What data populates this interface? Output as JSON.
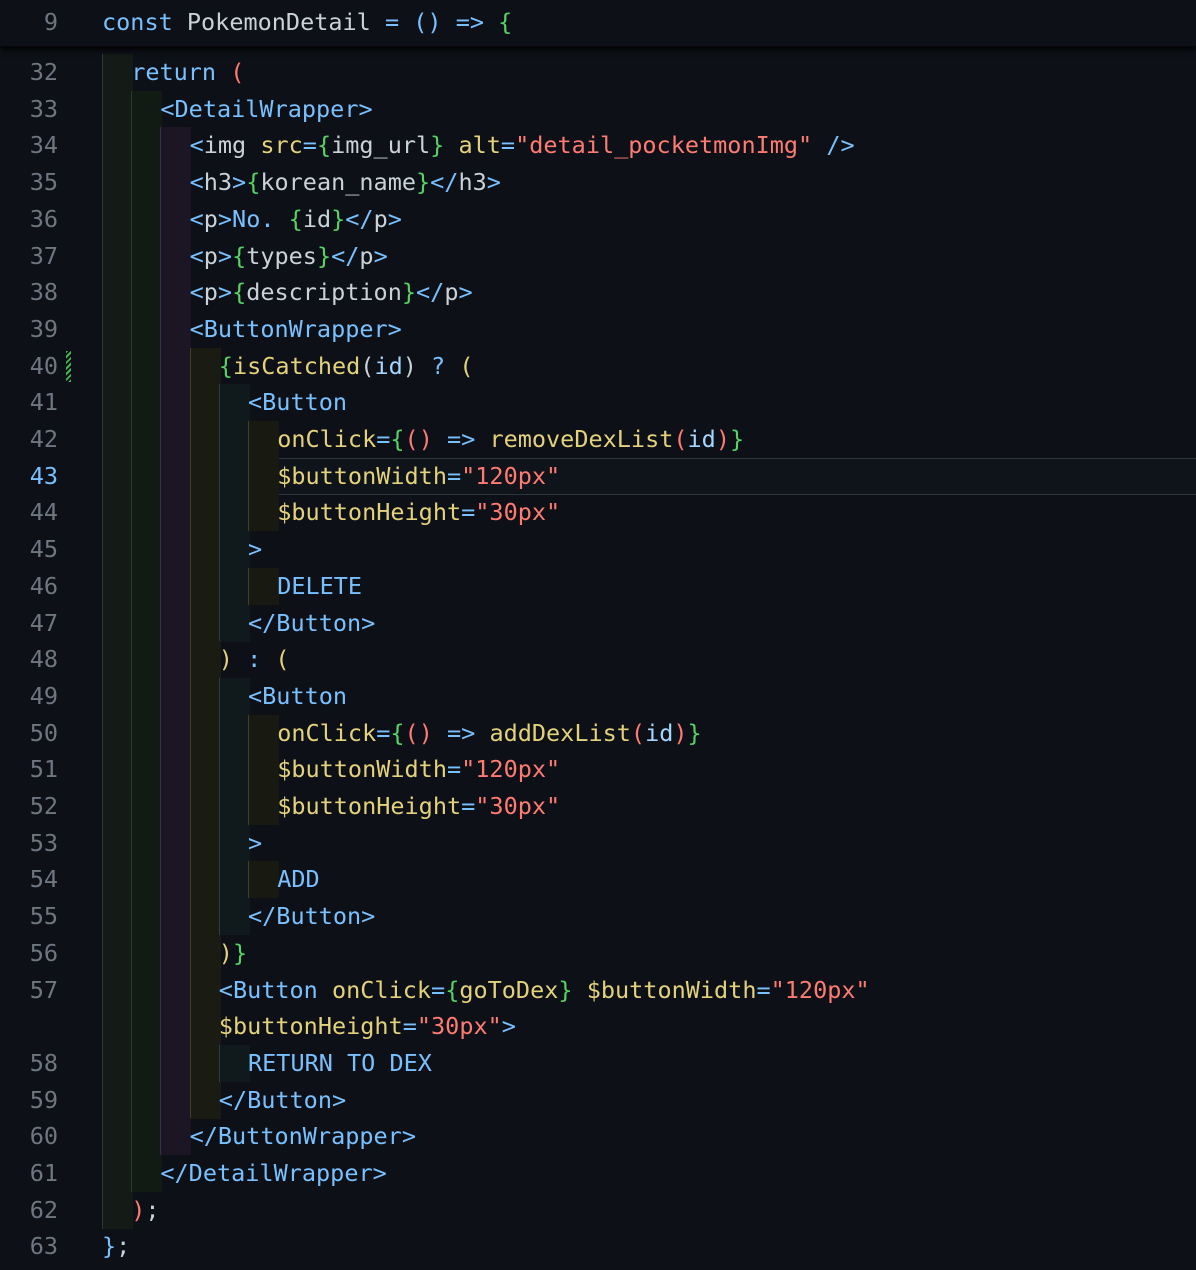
{
  "editor": {
    "sticky": {
      "number": "9",
      "tokens": [
        {
          "c": "k",
          "t": "const "
        },
        {
          "c": "t",
          "t": "PokemonDetail "
        },
        {
          "c": "k",
          "t": "= () => "
        },
        {
          "c": "b",
          "t": "{"
        }
      ]
    },
    "cursor_line": "43",
    "lines": [
      {
        "n": "32",
        "g": [
          0
        ],
        "tokens": [
          {
            "c": "k",
            "t": "return "
          },
          {
            "c": "p",
            "t": "("
          }
        ]
      },
      {
        "n": "33",
        "g": [
          0,
          1
        ],
        "tokens": [
          {
            "c": "k",
            "t": "<DetailWrapper>"
          }
        ]
      },
      {
        "n": "34",
        "g": [
          0,
          1,
          2
        ],
        "tokens": [
          {
            "c": "k",
            "t": "<"
          },
          {
            "c": "t",
            "t": "img "
          },
          {
            "c": "a",
            "t": "src"
          },
          {
            "c": "k",
            "t": "="
          },
          {
            "c": "b",
            "t": "{"
          },
          {
            "c": "t",
            "t": "img_url"
          },
          {
            "c": "b",
            "t": "}"
          },
          {
            "c": "t",
            "t": " "
          },
          {
            "c": "a",
            "t": "alt"
          },
          {
            "c": "k",
            "t": "="
          },
          {
            "c": "s",
            "t": "\"detail_pocketmonImg\""
          },
          {
            "c": "k",
            "t": " />"
          }
        ]
      },
      {
        "n": "35",
        "g": [
          0,
          1,
          2
        ],
        "tokens": [
          {
            "c": "k",
            "t": "<"
          },
          {
            "c": "t",
            "t": "h3"
          },
          {
            "c": "k",
            "t": ">"
          },
          {
            "c": "b",
            "t": "{"
          },
          {
            "c": "t",
            "t": "korean_name"
          },
          {
            "c": "b",
            "t": "}"
          },
          {
            "c": "k",
            "t": "</"
          },
          {
            "c": "t",
            "t": "h3"
          },
          {
            "c": "k",
            "t": ">"
          }
        ]
      },
      {
        "n": "36",
        "g": [
          0,
          1,
          2
        ],
        "tokens": [
          {
            "c": "k",
            "t": "<"
          },
          {
            "c": "t",
            "t": "p"
          },
          {
            "c": "k",
            "t": ">No. "
          },
          {
            "c": "b",
            "t": "{"
          },
          {
            "c": "t",
            "t": "id"
          },
          {
            "c": "b",
            "t": "}"
          },
          {
            "c": "k",
            "t": "</"
          },
          {
            "c": "t",
            "t": "p"
          },
          {
            "c": "k",
            "t": ">"
          }
        ]
      },
      {
        "n": "37",
        "g": [
          0,
          1,
          2
        ],
        "tokens": [
          {
            "c": "k",
            "t": "<"
          },
          {
            "c": "t",
            "t": "p"
          },
          {
            "c": "k",
            "t": ">"
          },
          {
            "c": "b",
            "t": "{"
          },
          {
            "c": "t",
            "t": "types"
          },
          {
            "c": "b",
            "t": "}"
          },
          {
            "c": "k",
            "t": "</"
          },
          {
            "c": "t",
            "t": "p"
          },
          {
            "c": "k",
            "t": ">"
          }
        ]
      },
      {
        "n": "38",
        "g": [
          0,
          1,
          2
        ],
        "tokens": [
          {
            "c": "k",
            "t": "<"
          },
          {
            "c": "t",
            "t": "p"
          },
          {
            "c": "k",
            "t": ">"
          },
          {
            "c": "b",
            "t": "{"
          },
          {
            "c": "t",
            "t": "description"
          },
          {
            "c": "b",
            "t": "}"
          },
          {
            "c": "k",
            "t": "</"
          },
          {
            "c": "t",
            "t": "p"
          },
          {
            "c": "k",
            "t": ">"
          }
        ]
      },
      {
        "n": "39",
        "g": [
          0,
          1,
          2
        ],
        "tokens": [
          {
            "c": "k",
            "t": "<ButtonWrapper>"
          }
        ]
      },
      {
        "n": "40",
        "g": [
          0,
          1,
          2,
          3
        ],
        "tokens": [
          {
            "c": "b",
            "t": "{"
          },
          {
            "c": "a",
            "t": "isCatched"
          },
          {
            "c": "t",
            "t": "("
          },
          {
            "c": "v",
            "t": "id"
          },
          {
            "c": "t",
            "t": ") "
          },
          {
            "c": "k",
            "t": "? "
          },
          {
            "c": "a",
            "t": "("
          }
        ]
      },
      {
        "n": "41",
        "g": [
          0,
          1,
          2,
          3,
          4
        ],
        "tokens": [
          {
            "c": "k",
            "t": "<Button"
          }
        ]
      },
      {
        "n": "42",
        "g": [
          0,
          1,
          2,
          3,
          4,
          5
        ],
        "tokens": [
          {
            "c": "a",
            "t": "onClick"
          },
          {
            "c": "k",
            "t": "="
          },
          {
            "c": "b",
            "t": "{"
          },
          {
            "c": "p",
            "t": "()"
          },
          {
            "c": "k",
            "t": " => "
          },
          {
            "c": "a",
            "t": "removeDexList"
          },
          {
            "c": "p",
            "t": "("
          },
          {
            "c": "v",
            "t": "id"
          },
          {
            "c": "p",
            "t": ")"
          },
          {
            "c": "b",
            "t": "}"
          }
        ]
      },
      {
        "n": "43",
        "g": [
          0,
          1,
          2,
          3,
          4,
          5
        ],
        "tokens": [
          {
            "c": "a",
            "t": "$buttonWidth"
          },
          {
            "c": "k",
            "t": "="
          },
          {
            "c": "s",
            "t": "\"120px\""
          }
        ]
      },
      {
        "n": "44",
        "g": [
          0,
          1,
          2,
          3,
          4,
          5
        ],
        "tokens": [
          {
            "c": "a",
            "t": "$buttonHeight"
          },
          {
            "c": "k",
            "t": "="
          },
          {
            "c": "s",
            "t": "\"30px\""
          }
        ]
      },
      {
        "n": "45",
        "g": [
          0,
          1,
          2,
          3,
          4
        ],
        "tokens": [
          {
            "c": "k",
            "t": ">"
          }
        ]
      },
      {
        "n": "46",
        "g": [
          0,
          1,
          2,
          3,
          4,
          5
        ],
        "tokens": [
          {
            "c": "k",
            "t": "DELETE"
          }
        ]
      },
      {
        "n": "47",
        "g": [
          0,
          1,
          2,
          3,
          4
        ],
        "tokens": [
          {
            "c": "k",
            "t": "</Button>"
          }
        ]
      },
      {
        "n": "48",
        "g": [
          0,
          1,
          2,
          3
        ],
        "tokens": [
          {
            "c": "a",
            "t": ")"
          },
          {
            "c": "k",
            "t": " : "
          },
          {
            "c": "a",
            "t": "("
          }
        ]
      },
      {
        "n": "49",
        "g": [
          0,
          1,
          2,
          3,
          4
        ],
        "tokens": [
          {
            "c": "k",
            "t": "<Button"
          }
        ]
      },
      {
        "n": "50",
        "g": [
          0,
          1,
          2,
          3,
          4,
          5
        ],
        "tokens": [
          {
            "c": "a",
            "t": "onClick"
          },
          {
            "c": "k",
            "t": "="
          },
          {
            "c": "b",
            "t": "{"
          },
          {
            "c": "p",
            "t": "()"
          },
          {
            "c": "k",
            "t": " => "
          },
          {
            "c": "a",
            "t": "addDexList"
          },
          {
            "c": "p",
            "t": "("
          },
          {
            "c": "v",
            "t": "id"
          },
          {
            "c": "p",
            "t": ")"
          },
          {
            "c": "b",
            "t": "}"
          }
        ]
      },
      {
        "n": "51",
        "g": [
          0,
          1,
          2,
          3,
          4,
          5
        ],
        "tokens": [
          {
            "c": "a",
            "t": "$buttonWidth"
          },
          {
            "c": "k",
            "t": "="
          },
          {
            "c": "s",
            "t": "\"120px\""
          }
        ]
      },
      {
        "n": "52",
        "g": [
          0,
          1,
          2,
          3,
          4,
          5
        ],
        "tokens": [
          {
            "c": "a",
            "t": "$buttonHeight"
          },
          {
            "c": "k",
            "t": "="
          },
          {
            "c": "s",
            "t": "\"30px\""
          }
        ]
      },
      {
        "n": "53",
        "g": [
          0,
          1,
          2,
          3,
          4
        ],
        "tokens": [
          {
            "c": "k",
            "t": ">"
          }
        ]
      },
      {
        "n": "54",
        "g": [
          0,
          1,
          2,
          3,
          4,
          5
        ],
        "tokens": [
          {
            "c": "k",
            "t": "ADD"
          }
        ]
      },
      {
        "n": "55",
        "g": [
          0,
          1,
          2,
          3,
          4
        ],
        "tokens": [
          {
            "c": "k",
            "t": "</Button>"
          }
        ]
      },
      {
        "n": "56",
        "g": [
          0,
          1,
          2,
          3
        ],
        "tokens": [
          {
            "c": "a",
            "t": ")"
          },
          {
            "c": "b",
            "t": "}"
          }
        ]
      },
      {
        "n": "57",
        "g": [
          0,
          1,
          2,
          3
        ],
        "tokens": [
          {
            "c": "k",
            "t": "<Button "
          },
          {
            "c": "a",
            "t": "onClick"
          },
          {
            "c": "k",
            "t": "="
          },
          {
            "c": "b",
            "t": "{"
          },
          {
            "c": "a",
            "t": "goToDex"
          },
          {
            "c": "b",
            "t": "}"
          },
          {
            "c": "t",
            "t": " "
          },
          {
            "c": "a",
            "t": "$buttonWidth"
          },
          {
            "c": "k",
            "t": "="
          },
          {
            "c": "s",
            "t": "\"120px\""
          }
        ]
      },
      {
        "n": "",
        "g": [
          0,
          1,
          2,
          3
        ],
        "tokens": [
          {
            "c": "a",
            "t": "$buttonHeight"
          },
          {
            "c": "k",
            "t": "="
          },
          {
            "c": "s",
            "t": "\"30px\""
          },
          {
            "c": "k",
            "t": ">"
          }
        ]
      },
      {
        "n": "58",
        "g": [
          0,
          1,
          2,
          3,
          4
        ],
        "tokens": [
          {
            "c": "k",
            "t": "RETURN TO DEX"
          }
        ]
      },
      {
        "n": "59",
        "g": [
          0,
          1,
          2,
          3
        ],
        "tokens": [
          {
            "c": "k",
            "t": "</Button>"
          }
        ]
      },
      {
        "n": "60",
        "g": [
          0,
          1,
          2
        ],
        "tokens": [
          {
            "c": "k",
            "t": "</ButtonWrapper>"
          }
        ]
      },
      {
        "n": "61",
        "g": [
          0,
          1
        ],
        "tokens": [
          {
            "c": "k",
            "t": "</DetailWrapper>"
          }
        ]
      },
      {
        "n": "62",
        "g": [
          0
        ],
        "tokens": [
          {
            "c": "p",
            "t": ")"
          },
          {
            "c": "t",
            "t": ";"
          }
        ]
      },
      {
        "n": "63",
        "g": [],
        "tokens": [
          {
            "c": "k",
            "t": "}"
          },
          {
            "c": "t",
            "t": ";"
          }
        ]
      }
    ],
    "modified_line": "40"
  }
}
